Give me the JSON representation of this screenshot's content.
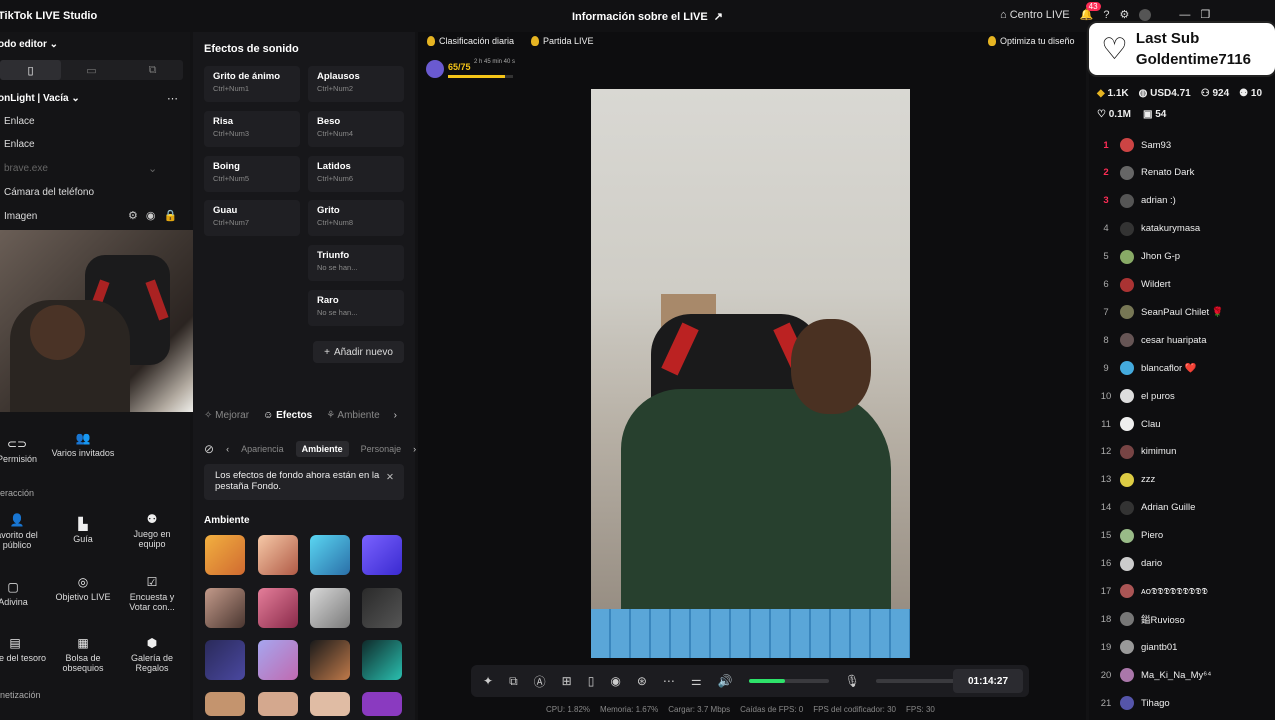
{
  "app": {
    "title": "TikTok LIVE Studio"
  },
  "header": {
    "center_title": "Información sobre el LIVE",
    "centro_live": "Centro LIVE",
    "notifications": "43"
  },
  "left": {
    "mode": "odo editor",
    "scene": "onLight | Vacía",
    "sources": [
      "Enlace",
      "Enlace",
      "brave.exe",
      "Cámara del teléfono",
      "Imagen"
    ],
    "tools_row1": [
      {
        "label": "Permisión"
      },
      {
        "label": "Varios invitados"
      }
    ],
    "section_interaction": "eracción",
    "tools_row2": [
      {
        "label": "avorito del público"
      },
      {
        "label": "Guía"
      },
      {
        "label": "Juego en equipo"
      }
    ],
    "tools_row3": [
      {
        "label": "Adivina"
      },
      {
        "label": "Objetivo LIVE"
      },
      {
        "label": "Encuesta y Votar con..."
      }
    ],
    "tools_row4": [
      {
        "label": "cofre del tesoro"
      },
      {
        "label": "Bolsa de obsequios"
      },
      {
        "label": "Galería de Regalos"
      }
    ],
    "section_monetization": "netización"
  },
  "sounds": {
    "title": "Efectos de sonido",
    "items": [
      {
        "name": "Grito de ánimo",
        "key": "Ctrl+Num1"
      },
      {
        "name": "Aplausos",
        "key": "Ctrl+Num2"
      },
      {
        "name": "Risa",
        "key": "Ctrl+Num3"
      },
      {
        "name": "Beso",
        "key": "Ctrl+Num4"
      },
      {
        "name": "Boing",
        "key": "Ctrl+Num5"
      },
      {
        "name": "Latidos",
        "key": "Ctrl+Num6"
      },
      {
        "name": "Guau",
        "key": "Ctrl+Num7"
      },
      {
        "name": "Grito",
        "key": "Ctrl+Num8"
      },
      {
        "name": "Triunfo",
        "key": "No se han..."
      },
      {
        "name": "Raro",
        "key": "No se han..."
      }
    ],
    "add": "Añadir nuevo"
  },
  "effects": {
    "tabs": [
      "Mejorar",
      "Efectos",
      "Ambiente"
    ],
    "subtabs": [
      "Apariencia",
      "Ambiente",
      "Personaje"
    ],
    "notice": "Los efectos de fondo ahora están en la pestaña Fondo.",
    "section": "Ambiente"
  },
  "live": {
    "ranking": "Clasificación diaria",
    "partida": "Partida LIVE",
    "optimize": "Optimiza tu diseño",
    "progress_text": "65/75",
    "progress_pct": 0.87,
    "timeleft": "2 h 45 min 40 s"
  },
  "controls": {
    "timer": "01:14:27",
    "volume": 0.45
  },
  "stats": {
    "cpu": "CPU: 1.82%",
    "mem": "Memoria: 1.67%",
    "upload": "Cargar: 3.7 Mbps",
    "fps_drop": "Caídas de FPS: 0",
    "enc_fps": "FPS del codificador: 30",
    "fps": "FPS: 30"
  },
  "right": {
    "lastsub_label": "Last Sub",
    "lastsub_name": "Goldentime7116",
    "stat_coins": "1.1K",
    "stat_usd": "USD4.71",
    "stat_viewers": "924",
    "stat_extra": "10",
    "stat_likes": "0.1M",
    "stat_gifts": "54",
    "ranks": [
      {
        "n": "1",
        "name": "Sam93",
        "c": "#c44"
      },
      {
        "n": "2",
        "name": "Renato Dark",
        "c": "#666"
      },
      {
        "n": "3",
        "name": "adrian :)",
        "c": "#555"
      },
      {
        "n": "4",
        "name": "katakurymasa",
        "c": "#333"
      },
      {
        "n": "5",
        "name": "Jhon G-p",
        "c": "#8a6"
      },
      {
        "n": "6",
        "name": "Wildert",
        "c": "#a33"
      },
      {
        "n": "7",
        "name": "SeanPaul Chilet 🌹",
        "c": "#775"
      },
      {
        "n": "8",
        "name": "cesar huaripata",
        "c": "#655"
      },
      {
        "n": "9",
        "name": "blancaflor ❤️",
        "c": "#4ad"
      },
      {
        "n": "10",
        "name": "el puros",
        "c": "#ddd"
      },
      {
        "n": "11",
        "name": "Clau",
        "c": "#eee"
      },
      {
        "n": "12",
        "name": "kimimun",
        "c": "#744"
      },
      {
        "n": "13",
        "name": "zzz",
        "c": "#dc4"
      },
      {
        "n": "14",
        "name": "Adrian Guille",
        "c": "#333"
      },
      {
        "n": "15",
        "name": "Piero",
        "c": "#9b8"
      },
      {
        "n": "16",
        "name": "dario",
        "c": "#ccc"
      },
      {
        "n": "17",
        "name": "ᴀᴏ𝕯𝕯𝕯𝕯𝕯𝕯𝕯𝕯𝕯",
        "c": "#a55"
      },
      {
        "n": "18",
        "name": "鎰Ruvioso",
        "c": "#777"
      },
      {
        "n": "19",
        "name": "giantb01",
        "c": "#999"
      },
      {
        "n": "20",
        "name": "Ma_Ki_Na_My⁶⁴",
        "c": "#a7a"
      },
      {
        "n": "21",
        "name": "Tihago",
        "c": "#55a"
      }
    ]
  },
  "colors": {
    "accent": "#fe2c55",
    "volume": "#2ee26a",
    "progress": "#f5c518"
  }
}
